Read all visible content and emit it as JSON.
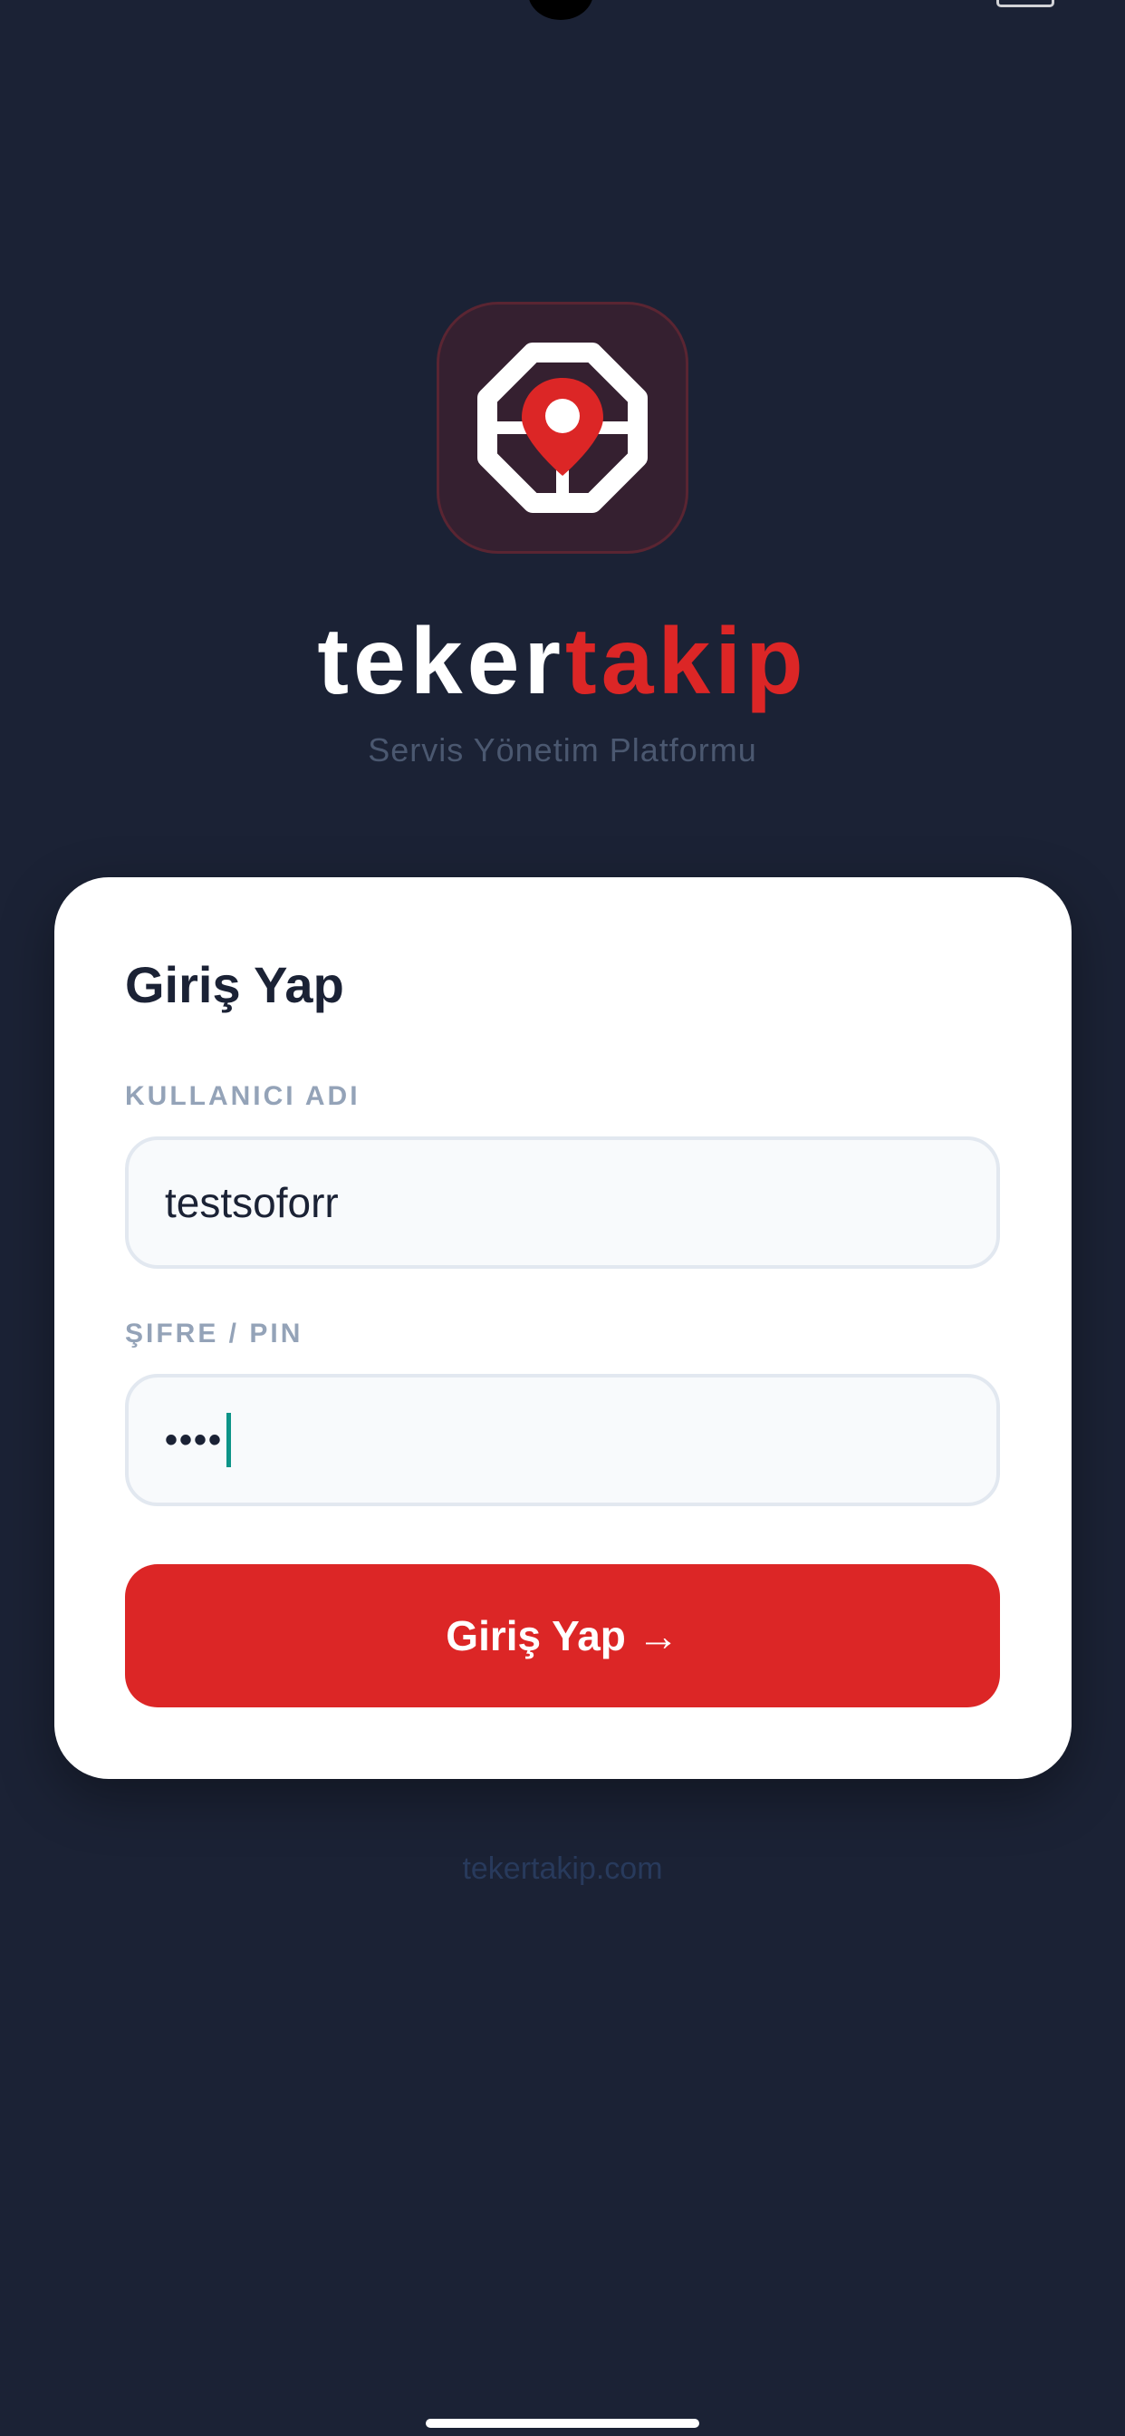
{
  "brand": {
    "name_part1": "teker",
    "name_part2": "takip",
    "tagline": "Servis Yönetim Platformu",
    "logo_icon": "steering-wheel-location-pin-icon",
    "accent_color": "#dc2626",
    "background_color": "#1b2235"
  },
  "login_card": {
    "title": "Giriş Yap",
    "username_label": "KULLANICI ADI",
    "username_value": "testsoforr",
    "password_label": "ŞIFRE / PIN",
    "password_value": "••••",
    "submit_label": "Giriş Yap →"
  },
  "footer": {
    "link_text": "tekertakip.com"
  }
}
